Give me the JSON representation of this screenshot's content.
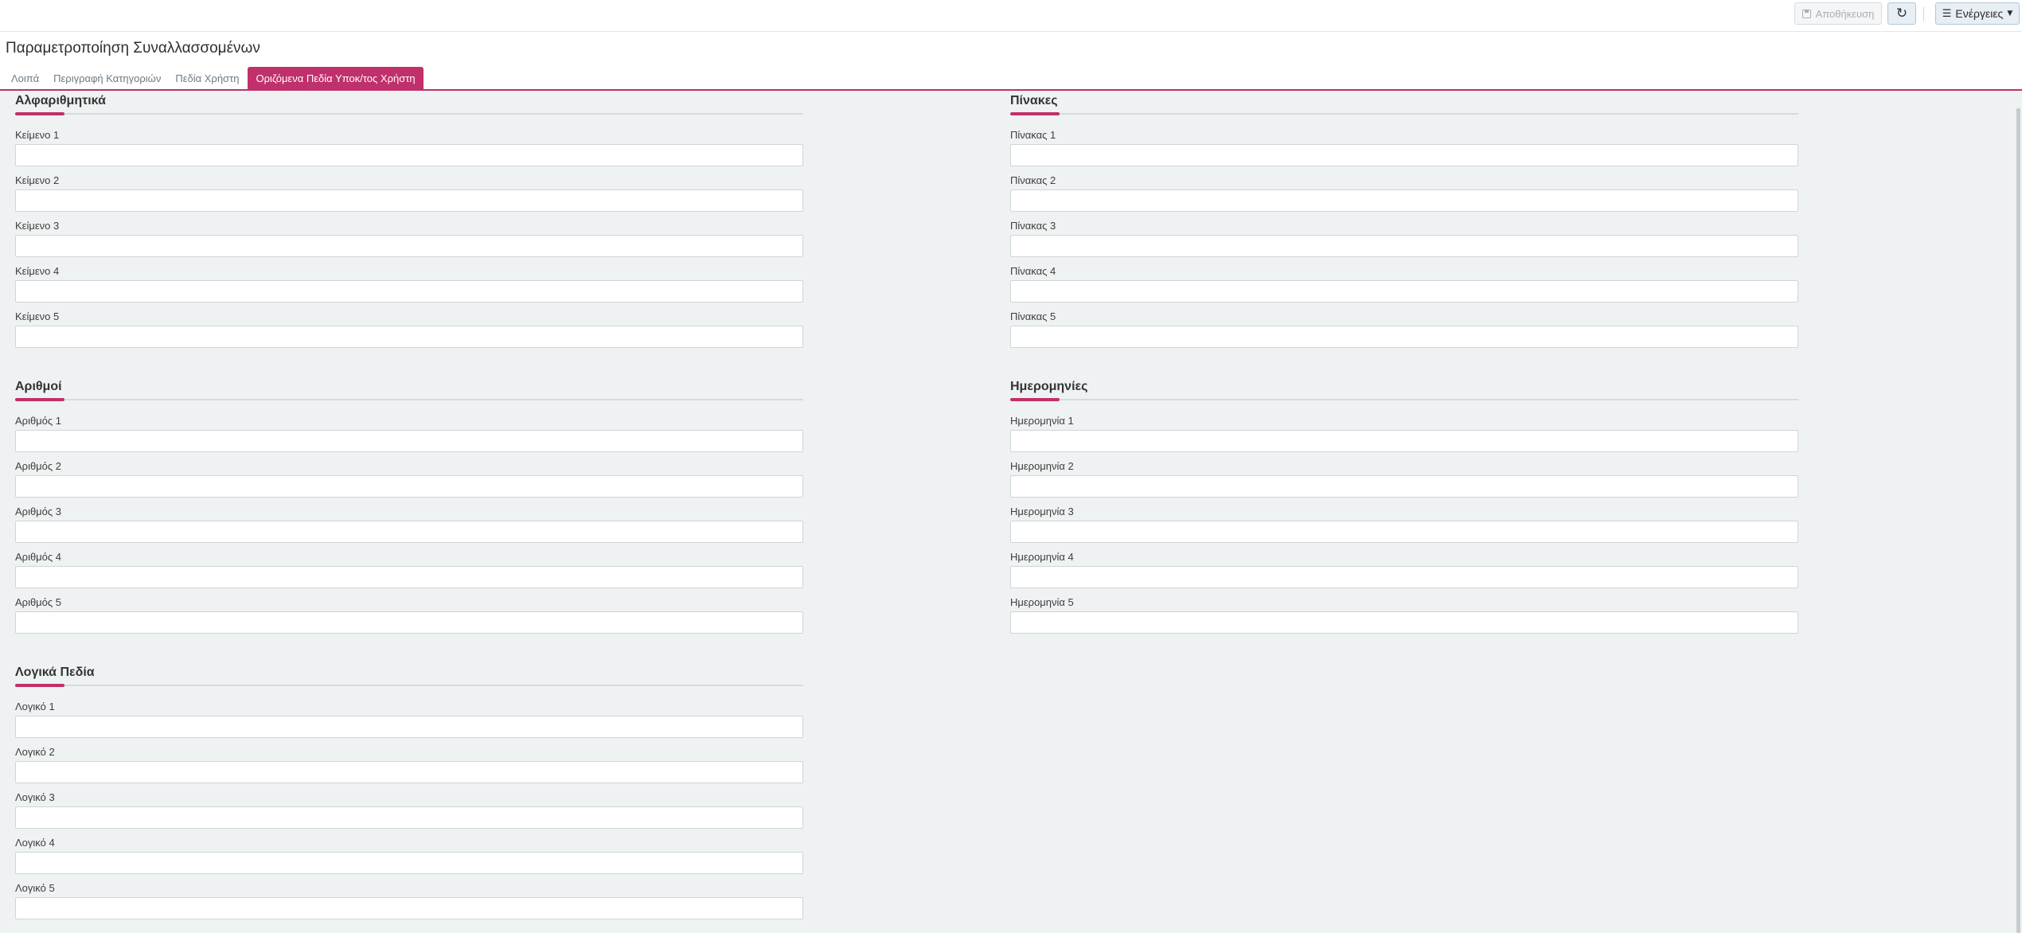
{
  "toolbar": {
    "save_label": "Αποθήκευση",
    "refresh_symbol": "↻",
    "actions_label": "Ενέργειες",
    "actions_icon": "☰",
    "actions_caret": "▼"
  },
  "page": {
    "title": "Παραμετροποίηση Συναλλασσομένων"
  },
  "tabs": [
    {
      "label": "Λοιπά"
    },
    {
      "label": "Περιγραφή Κατηγοριών"
    },
    {
      "label": "Πεδία Χρήστη"
    },
    {
      "label": "Οριζόμενα Πεδία Υποκ/τος Χρήστη"
    }
  ],
  "sections": {
    "alpha": {
      "title": "Αλφαριθμητικά",
      "fields": [
        {
          "label": "Κείμενο 1",
          "value": ""
        },
        {
          "label": "Κείμενο 2",
          "value": ""
        },
        {
          "label": "Κείμενο 3",
          "value": ""
        },
        {
          "label": "Κείμενο 4",
          "value": ""
        },
        {
          "label": "Κείμενο 5",
          "value": ""
        }
      ]
    },
    "tables": {
      "title": "Πίνακες",
      "fields": [
        {
          "label": "Πίνακας 1",
          "value": ""
        },
        {
          "label": "Πίνακας 2",
          "value": ""
        },
        {
          "label": "Πίνακας 3",
          "value": ""
        },
        {
          "label": "Πίνακας 4",
          "value": ""
        },
        {
          "label": "Πίνακας 5",
          "value": ""
        }
      ]
    },
    "numbers": {
      "title": "Αριθμοί",
      "fields": [
        {
          "label": "Αριθμός 1",
          "value": ""
        },
        {
          "label": "Αριθμός 2",
          "value": ""
        },
        {
          "label": "Αριθμός 3",
          "value": ""
        },
        {
          "label": "Αριθμός 4",
          "value": ""
        },
        {
          "label": "Αριθμός 5",
          "value": ""
        }
      ]
    },
    "dates": {
      "title": "Ημερομηνίες",
      "fields": [
        {
          "label": "Ημερομηνία 1",
          "value": ""
        },
        {
          "label": "Ημερομηνία 2",
          "value": ""
        },
        {
          "label": "Ημερομηνία 3",
          "value": ""
        },
        {
          "label": "Ημερομηνία 4",
          "value": ""
        },
        {
          "label": "Ημερομηνία 5",
          "value": ""
        }
      ]
    },
    "logical": {
      "title": "Λογικά Πεδία",
      "fields": [
        {
          "label": "Λογικό 1",
          "value": ""
        },
        {
          "label": "Λογικό 2",
          "value": ""
        },
        {
          "label": "Λογικό 3",
          "value": ""
        },
        {
          "label": "Λογικό 4",
          "value": ""
        },
        {
          "label": "Λογικό 5",
          "value": ""
        }
      ]
    }
  },
  "colors": {
    "accent": "#c0306a",
    "content_bg": "#eff2f3"
  }
}
